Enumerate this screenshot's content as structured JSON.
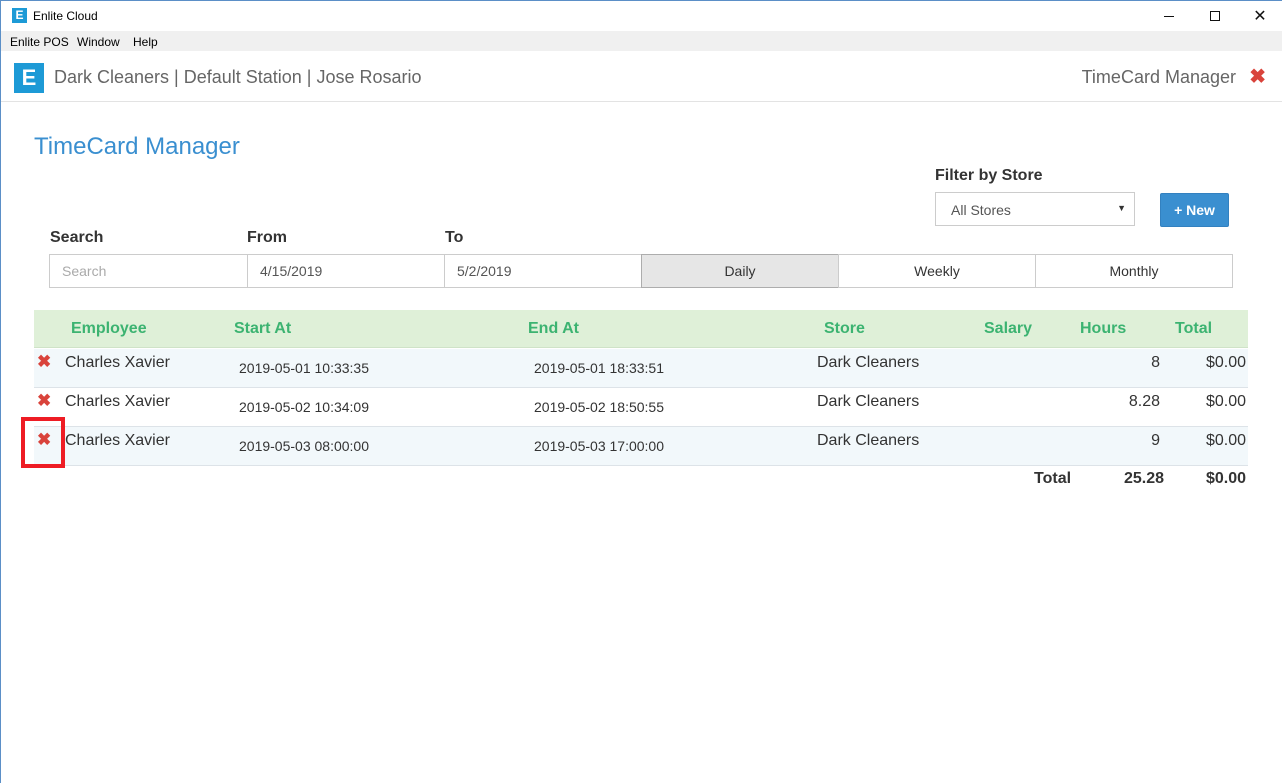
{
  "window": {
    "title": "Enlite Cloud",
    "icon_letter": "E",
    "minimize_icon": "minimize-icon",
    "maximize_icon": "maximize-icon",
    "close_glyph": "✕"
  },
  "menubar": {
    "items": [
      "Enlite POS",
      "Window",
      "Help"
    ]
  },
  "header": {
    "logo_letter": "E",
    "context": "Dark Cleaners | Default Station | Jose Rosario",
    "module": "TimeCard Manager",
    "close_glyph": "✖"
  },
  "page": {
    "title": "TimeCard Manager",
    "filter_label": "Filter by Store",
    "store_selected": "All Stores",
    "new_button": "+ New",
    "search_label": "Search",
    "search_placeholder": "Search",
    "from_label": "From",
    "from_value": "4/15/2019",
    "to_label": "To",
    "to_value": "5/2/2019",
    "periods": [
      "Daily",
      "Weekly",
      "Monthly"
    ],
    "active_period": "Daily"
  },
  "table": {
    "columns": [
      "Employee",
      "Start At",
      "End At",
      "Store",
      "Salary",
      "Hours",
      "Total"
    ],
    "rows": [
      {
        "employee": "Charles Xavier",
        "start": "2019-05-01 10:33:35",
        "end": "2019-05-01 18:33:51",
        "store": "Dark Cleaners",
        "salary": "",
        "hours": "8",
        "total": "$0.00"
      },
      {
        "employee": "Charles Xavier",
        "start": "2019-05-02 10:34:09",
        "end": "2019-05-02 18:50:55",
        "store": "Dark Cleaners",
        "salary": "",
        "hours": "8.28",
        "total": "$0.00"
      },
      {
        "employee": "Charles Xavier",
        "start": "2019-05-03 08:00:00",
        "end": "2019-05-03 17:00:00",
        "store": "Dark Cleaners",
        "salary": "",
        "hours": "9",
        "total": "$0.00"
      }
    ],
    "delete_glyph": "✖",
    "totals": {
      "label": "Total",
      "hours": "25.28",
      "amount": "$0.00"
    }
  },
  "colors": {
    "accent": "#3a8fd0",
    "header_green": "#3cb371",
    "delete_red": "#d9433b",
    "highlight": "#ee1c24"
  }
}
